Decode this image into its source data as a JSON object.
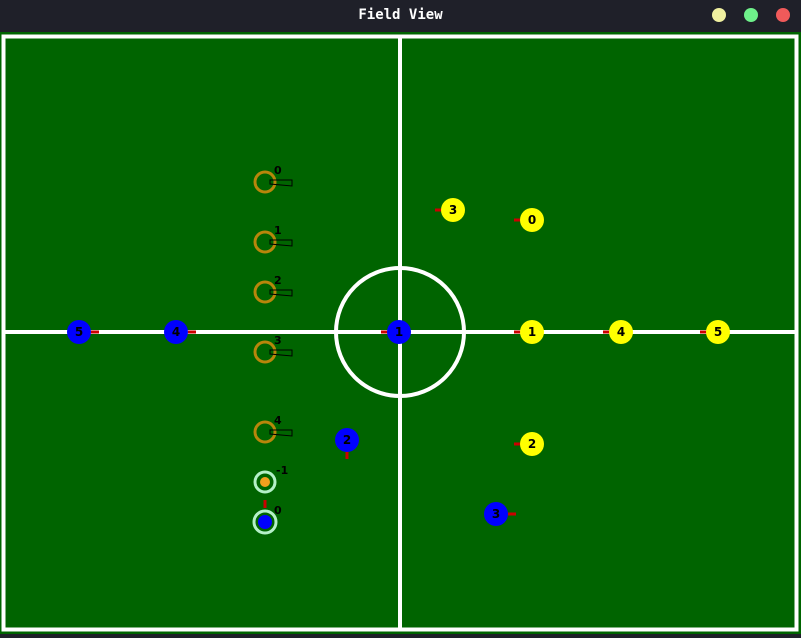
{
  "window": {
    "title": "Field View",
    "buttons": [
      "minimize-button",
      "maximize-button",
      "close-button"
    ]
  },
  "colors": {
    "field": "#006400",
    "lines": "#ffffff",
    "blue_team": "#0000ff",
    "yellow_team": "#ffff00",
    "heading": "#cc0000",
    "target_ring": "#b8860b",
    "ball": "#f2a01e",
    "highlight_ring": "#b4f0c8"
  },
  "field": {
    "blue_robots": [
      {
        "id": "0",
        "label": "0"
      },
      {
        "id": "1",
        "label": "1"
      },
      {
        "id": "2",
        "label": "2"
      },
      {
        "id": "3",
        "label": "3"
      },
      {
        "id": "4",
        "label": "4"
      },
      {
        "id": "5",
        "label": "5"
      }
    ],
    "yellow_robots": [
      {
        "id": "0",
        "label": "0"
      },
      {
        "id": "1",
        "label": "1"
      },
      {
        "id": "2",
        "label": "2"
      },
      {
        "id": "3",
        "label": "3"
      },
      {
        "id": "4",
        "label": "4"
      },
      {
        "id": "5",
        "label": "5"
      }
    ],
    "targets": [
      {
        "label": "0"
      },
      {
        "label": "1"
      },
      {
        "label": "2"
      },
      {
        "label": "3"
      },
      {
        "label": "4"
      }
    ],
    "ball_label": "-1"
  }
}
